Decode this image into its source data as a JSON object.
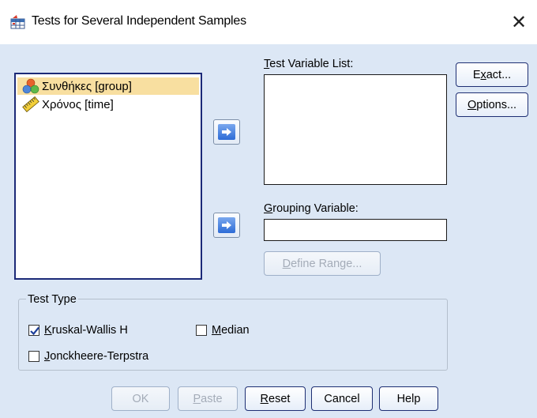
{
  "window": {
    "title": "Tests for Several Independent Samples"
  },
  "source_list": {
    "items": [
      {
        "label": "Συνθήκες [group]",
        "icon": "nominal-variable-icon",
        "selected": true
      },
      {
        "label": "Χρόνος [time]",
        "icon": "scale-variable-icon",
        "selected": false
      }
    ]
  },
  "test_variable_list": {
    "label_underlined": "T",
    "label_rest": "est Variable List:"
  },
  "grouping_variable": {
    "label_underlined": "G",
    "label_rest": "rouping Variable:",
    "value": ""
  },
  "side_buttons": {
    "exact": {
      "pre": "E",
      "u": "x",
      "post": "act..."
    },
    "options": {
      "pre": "",
      "u": "O",
      "post": "ptions..."
    }
  },
  "define_range": {
    "pre": "",
    "u": "D",
    "post": "efine Range..."
  },
  "test_type": {
    "title": "Test Type",
    "kruskal": {
      "u": "K",
      "rest": "ruskal-Wallis H",
      "checked": true
    },
    "median": {
      "u": "M",
      "rest": "edian",
      "checked": false
    },
    "jonckheere": {
      "u": "J",
      "rest": "onckheere-Terpstra",
      "checked": false
    }
  },
  "bottom_buttons": {
    "ok": "OK",
    "paste": {
      "u": "P",
      "rest": "aste"
    },
    "reset": {
      "u": "R",
      "rest": "eset"
    },
    "cancel": "Cancel",
    "help": "Help"
  },
  "colors": {
    "accent_border": "#1c2a78",
    "selection": "#f8dfa0",
    "dialog_bg": "#dce7f5"
  }
}
